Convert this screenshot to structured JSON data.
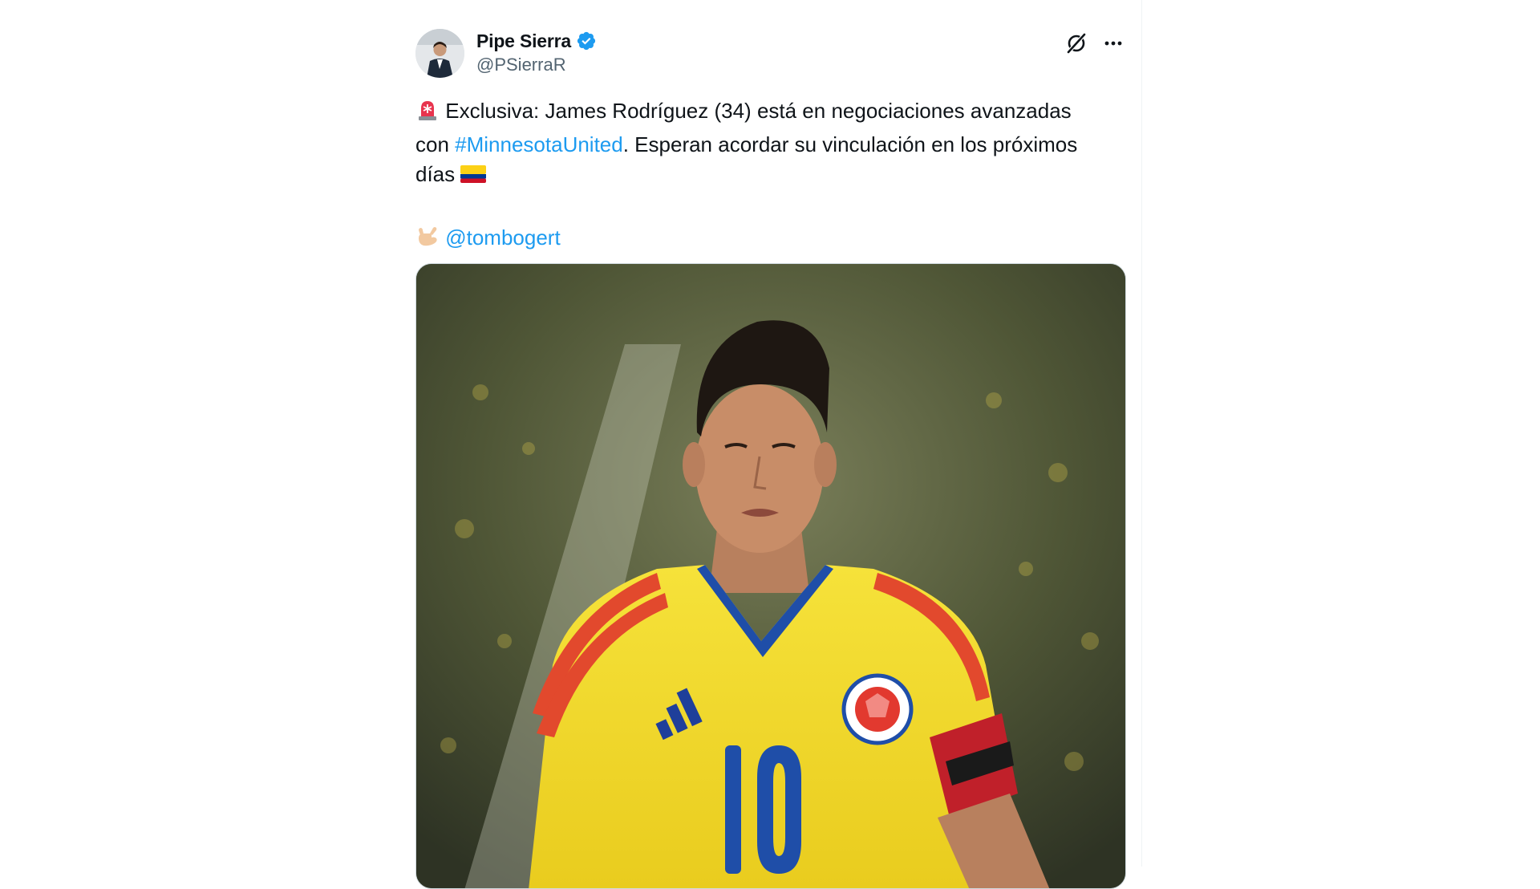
{
  "tweet": {
    "author": {
      "display_name": "Pipe Sierra",
      "handle": "@PSierraR",
      "verified": true,
      "verified_color": "#1d9bf0"
    },
    "text": {
      "line1_prefix_emoji": "siren-emoji",
      "line1": "Exclusiva: James Rodríguez (34) está en negociaciones avanzadas",
      "line2_before": "con ",
      "hashtag": "#MinnesotaUnited",
      "line2_after": ". Esperan acordar su vinculación en los próximos",
      "line3": "días",
      "line3_suffix_emoji": "colombia-flag-emoji",
      "credit_emoji": "call-me-hand-emoji",
      "mention": "@tombogert"
    },
    "media": {
      "type": "photo",
      "shirt_number": "10"
    },
    "colors": {
      "link": "#1d9bf0",
      "secondary_text": "#536471",
      "primary_text": "#0f1419"
    }
  }
}
